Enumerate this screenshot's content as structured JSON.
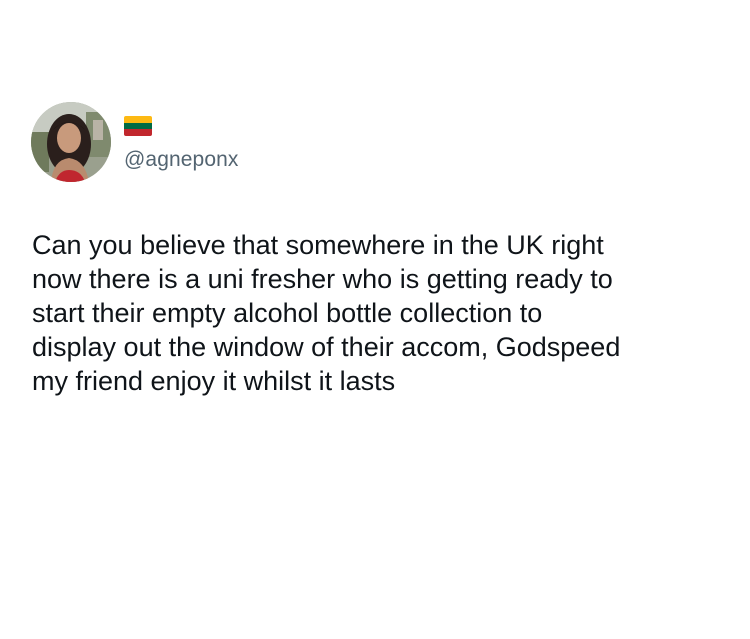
{
  "author": {
    "handle": "@agneponx",
    "avatar_icon": "profile-photo-avatar",
    "flag_icon": "lithuania-flag-icon",
    "flag_colors": [
      "#FDB913",
      "#006A44",
      "#C1272D"
    ]
  },
  "tweet": {
    "text": "Can you believe that somewhere in the UK right\nnow there is a uni fresher who is getting ready to\nstart their empty alcohol bottle collection to\ndisplay out the window of their accom, Godspeed\nmy friend enjoy it whilst it lasts"
  },
  "colors": {
    "background": "#ffffff",
    "text": "#0f1419",
    "handle": "#536471"
  }
}
